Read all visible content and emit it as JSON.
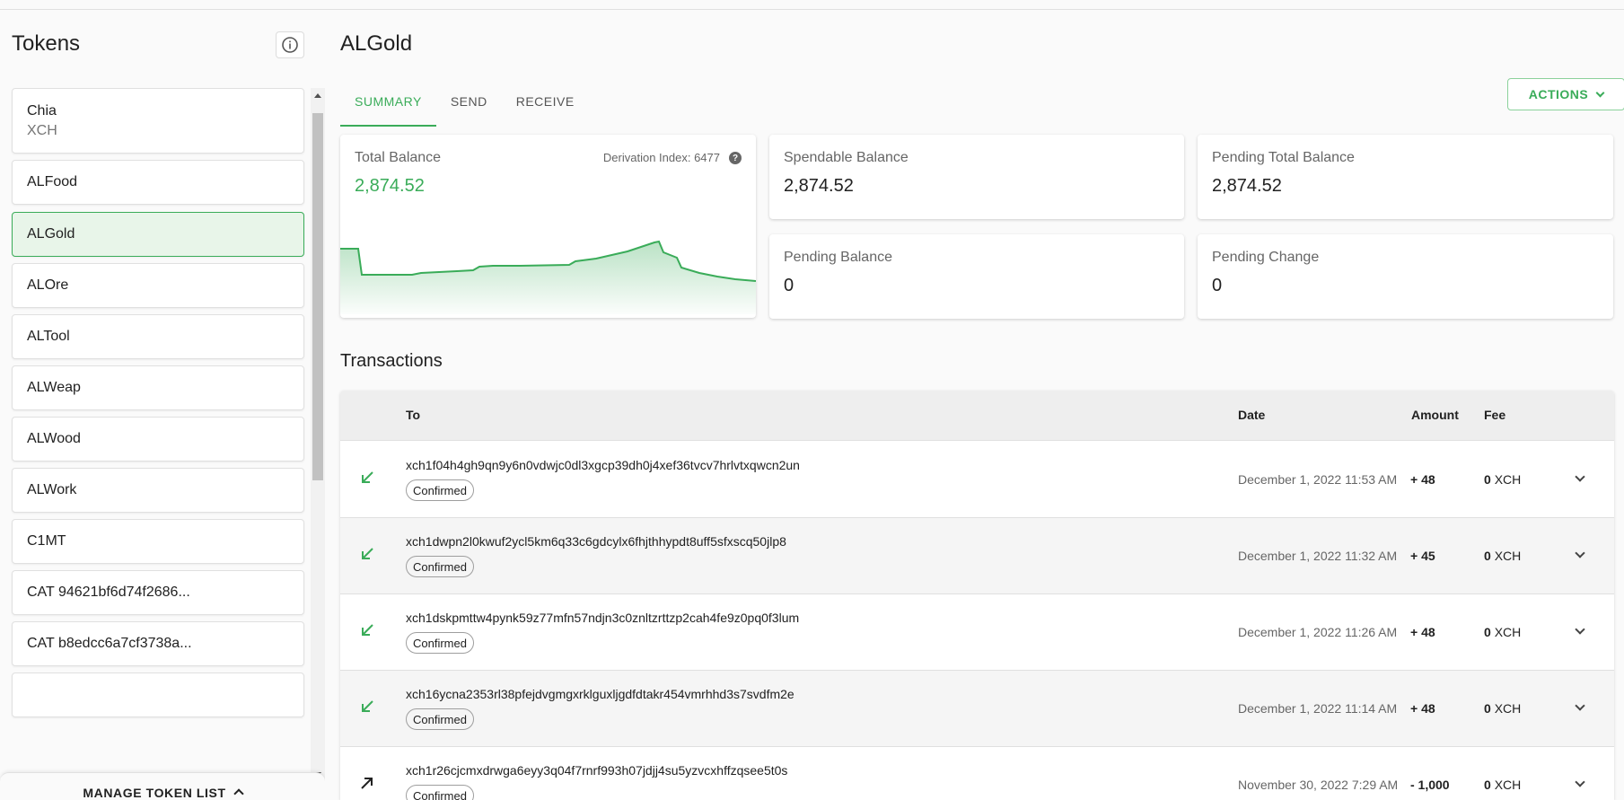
{
  "sidebar": {
    "title": "Tokens",
    "info_icon": "info-icon",
    "tokens": [
      {
        "name": "Chia",
        "symbol": "XCH"
      },
      {
        "name": "ALFood"
      },
      {
        "name": "ALGold",
        "active": true
      },
      {
        "name": "ALOre"
      },
      {
        "name": "ALTool"
      },
      {
        "name": "ALWeap"
      },
      {
        "name": "ALWood"
      },
      {
        "name": "ALWork"
      },
      {
        "name": "C1MT"
      },
      {
        "name": "CAT 94621bf6d74f2686..."
      },
      {
        "name": "CAT b8edcc6a7cf3738a..."
      }
    ],
    "manage_label": "MANAGE TOKEN LIST"
  },
  "main": {
    "title": "ALGold",
    "tabs": [
      "SUMMARY",
      "SEND",
      "RECEIVE"
    ],
    "actions_label": "ACTIONS",
    "cards": {
      "total_balance": {
        "label": "Total Balance",
        "value": "2,874.52",
        "derivation": "Derivation Index: 6477"
      },
      "spendable_balance": {
        "label": "Spendable Balance",
        "value": "2,874.52"
      },
      "pending_total_balance": {
        "label": "Pending Total Balance",
        "value": "2,874.52"
      },
      "pending_balance": {
        "label": "Pending Balance",
        "value": "0"
      },
      "pending_change": {
        "label": "Pending Change",
        "value": "0"
      }
    },
    "transactions": {
      "title": "Transactions",
      "headers": {
        "to": "To",
        "date": "Date",
        "amount": "Amount",
        "fee": "Fee"
      },
      "rows": [
        {
          "direction": "incoming",
          "to": "xch1f04h4gh9qn9y6n0vdwjc0dl3xgcp39dh0j4xef36tvcv7hrlvtxqwcn2un",
          "status": "Confirmed",
          "date": "December 1, 2022 11:53 AM",
          "amount": "+ 48",
          "fee_value": "0",
          "fee_unit": "XCH"
        },
        {
          "direction": "incoming",
          "to": "xch1dwpn2l0kwuf2ycl5km6q33c6gdcylx6fhjthhypdt8uff5sfxscq50jlp8",
          "status": "Confirmed",
          "date": "December 1, 2022 11:32 AM",
          "amount": "+ 45",
          "fee_value": "0",
          "fee_unit": "XCH"
        },
        {
          "direction": "incoming",
          "to": "xch1dskpmttw4pynk59z77mfn57ndjn3c0znltzrttzp2cah4fe9z0pq0f3lum",
          "status": "Confirmed",
          "date": "December 1, 2022 11:26 AM",
          "amount": "+ 48",
          "fee_value": "0",
          "fee_unit": "XCH"
        },
        {
          "direction": "incoming",
          "to": "xch16ycna2353rl38pfejdvgmgxrklguxljgdfdtakr454vmrhhd3s7svdfm2e",
          "status": "Confirmed",
          "date": "December 1, 2022 11:14 AM",
          "amount": "+ 48",
          "fee_value": "0",
          "fee_unit": "XCH"
        },
        {
          "direction": "outgoing",
          "to": "xch1r26cjcmxdrwga6eyy3q04f7rnrf993h07jdjj4su5yzvcxhffzqsee5t0s",
          "status": "Confirmed",
          "date": "November 30, 2022 7:29 AM",
          "amount": "- 1,000",
          "fee_value": "0",
          "fee_unit": "XCH"
        }
      ]
    }
  },
  "colors": {
    "accent": "#3aac59",
    "active_bg": "#e8f5e9"
  }
}
